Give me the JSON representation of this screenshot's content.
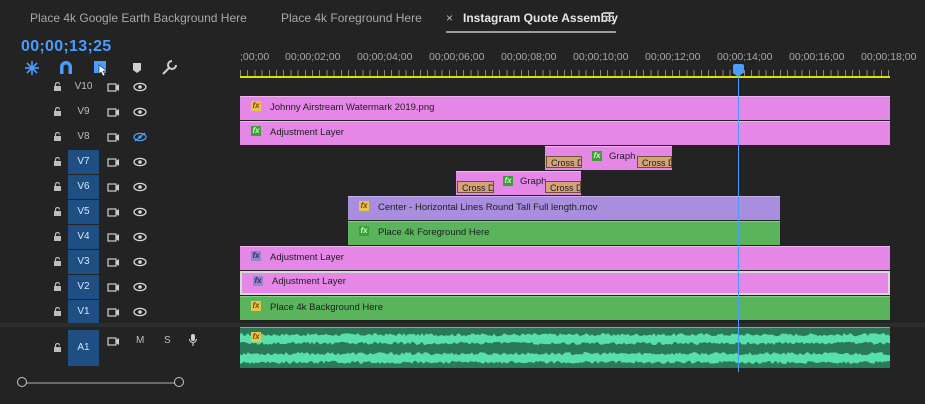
{
  "tabs": [
    {
      "label": "Place 4k Google Earth Background Here"
    },
    {
      "label": "Place 4k Foreground Here"
    },
    {
      "label": "Instagram Quote Assembly",
      "close": "×"
    }
  ],
  "timecode": "00;00;13;25",
  "tools": [
    "ripple-icon",
    "snap-magnet-icon",
    "linked-selection-icon",
    "marker-icon",
    "wrench-icon"
  ],
  "ruler": {
    "labels": [
      ";00;00",
      "00;00;02;00",
      "00;00;04;00",
      "00;00;06;00",
      "00;00;08;00",
      "00;00;10;00",
      "00;00;12;00",
      "00;00;14;00",
      "00;00;16;00",
      "00;00;18;00"
    ]
  },
  "tracks": [
    {
      "name": "V10",
      "target": false,
      "eye": "visible"
    },
    {
      "name": "V9",
      "target": false,
      "eye": "visible"
    },
    {
      "name": "V8",
      "target": false,
      "eye": "hidden"
    },
    {
      "name": "V7",
      "target": true,
      "eye": "visible"
    },
    {
      "name": "V6",
      "target": true,
      "eye": "visible"
    },
    {
      "name": "V5",
      "target": true,
      "eye": "visible"
    },
    {
      "name": "V4",
      "target": true,
      "eye": "visible"
    },
    {
      "name": "V3",
      "target": true,
      "eye": "visible"
    },
    {
      "name": "V2",
      "target": true,
      "eye": "visible"
    },
    {
      "name": "V1",
      "target": true,
      "eye": "visible"
    }
  ],
  "audio_track": {
    "name": "A1",
    "m": "M",
    "s": "S"
  },
  "clips": {
    "v9": "Johnny Airstream Watermark 2019.png",
    "v8": "Adjustment Layer",
    "v7_graph": "Graph",
    "v7_trans_a": "Cross D",
    "v7_trans_b": "Cross D",
    "v6_graph": "Graph",
    "v6_trans_a": "Cross D",
    "v6_trans_b": "Cross D",
    "v5": "Center - Horizontal Lines Round Tall Full length.mov",
    "v4": "Place 4k Foreground Here",
    "v3": "Adjustment Layer",
    "v2": "Adjustment Layer",
    "v1": "Place 4k Background Here",
    "fx": "fx"
  },
  "colors": {
    "accent": "#4b9cff",
    "pink_clip": "#e587e6",
    "green_clip": "#59b45c",
    "purple_clip": "#a98ee0",
    "audio": "#2a7a5a",
    "workarea": "#e0e000"
  }
}
